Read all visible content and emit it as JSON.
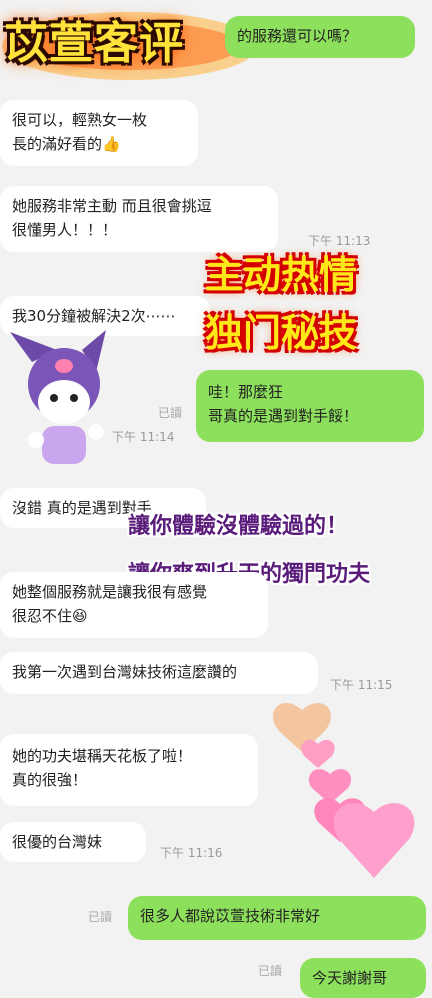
{
  "title": "苡萱客评",
  "messages": [
    {
      "side": "right",
      "text": "的服務還可以嗎？"
    },
    {
      "side": "left",
      "text": "很可以，輕熟女一枚\n長的滿好看的👍"
    },
    {
      "side": "left",
      "text": "她服務非常主動 而且很會挑逗\n很懂男人！！！"
    },
    {
      "side": "left",
      "text": "我30分鐘被解決2次⋯⋯"
    },
    {
      "side": "right",
      "text": "哇！那麼狂\n哥真的是遇到對手餒！"
    },
    {
      "side": "left",
      "text": "沒錯 真的是遇到對手"
    },
    {
      "side": "left",
      "text": "她整個服務就是讓我很有感覺\n很忍不住😆"
    },
    {
      "side": "left",
      "text": "我第一次遇到台灣妹技術這麼讚的"
    },
    {
      "side": "left",
      "text": "她的功夫堪稱天花板了啦！\n真的很強！"
    },
    {
      "side": "left",
      "text": "很優的台灣妹"
    },
    {
      "side": "right",
      "text": "很多人都說苡萱技術非常好"
    },
    {
      "side": "right",
      "text": "今天謝謝哥"
    }
  ],
  "times": [
    "下午 11:13",
    "下午 11:14",
    "下午 11:15",
    "下午 11:16"
  ],
  "read_label": "已讀",
  "promo_lines": [
    "主动热情",
    "独门秘技"
  ],
  "overlay_lines": [
    "讓你體驗沒體驗過的！",
    "讓你爽到升天的獨門功夫"
  ],
  "colors": {
    "incoming": "#ffffff",
    "outgoing": "#8de05c",
    "background": "#f2f2f2"
  }
}
